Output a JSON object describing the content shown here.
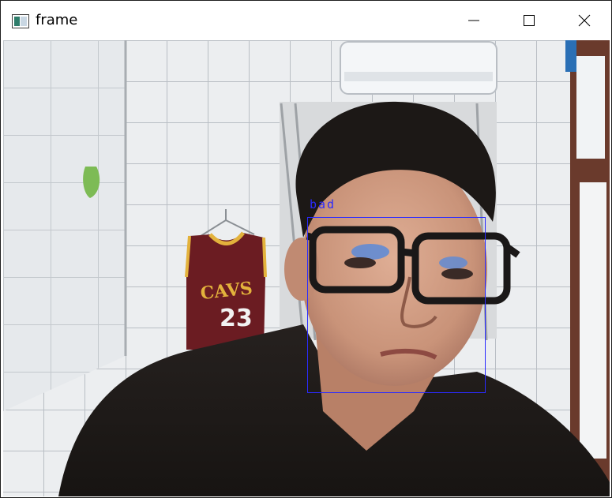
{
  "window": {
    "title": "frame",
    "icon": "opencv-window-icon",
    "controls": {
      "minimize": "minimize-icon",
      "maximize": "maximize-icon",
      "close": "close-icon"
    }
  },
  "frame": {
    "description_icon": "webcam-frame",
    "detection": {
      "label": "bad",
      "color": "#2b2bff"
    },
    "jersey_number": "23",
    "jersey_text": "CAVS"
  },
  "colors": {
    "titlebar_bg": "#ffffff",
    "title_text": "#000000",
    "box_color": "#2b2bff"
  }
}
